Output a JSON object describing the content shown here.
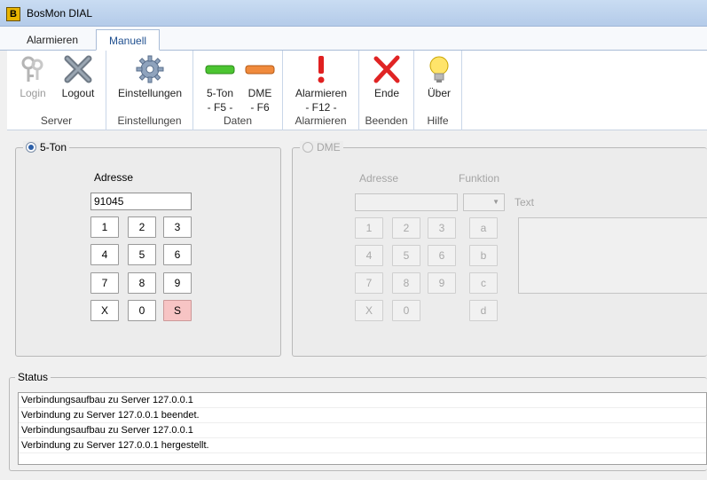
{
  "window": {
    "title": "BosMon DIAL",
    "icon_letter": "B"
  },
  "tabs": [
    {
      "label": "Alarmieren"
    },
    {
      "label": "Manuell"
    }
  ],
  "ribbon": {
    "groups": [
      {
        "label": "Server",
        "buttons": [
          {
            "label": "Login"
          },
          {
            "label": "Logout"
          }
        ]
      },
      {
        "label": "Einstellungen",
        "buttons": [
          {
            "label": "Einstellungen"
          }
        ]
      },
      {
        "label": "Daten",
        "buttons": [
          {
            "line1": "5-Ton",
            "line2": "- F5 -"
          },
          {
            "line1": "DME",
            "line2": "- F6"
          }
        ]
      },
      {
        "label": "Alarmieren",
        "buttons": [
          {
            "line1": "Alarmieren",
            "line2": "- F12 -"
          }
        ]
      },
      {
        "label": "Beenden",
        "buttons": [
          {
            "label": "Ende"
          }
        ]
      },
      {
        "label": "Hilfe",
        "buttons": [
          {
            "label": "Über"
          }
        ]
      }
    ]
  },
  "five_tone": {
    "legend": "5-Ton",
    "address_label": "Adresse",
    "address_value": "91045",
    "keys": [
      "1",
      "2",
      "3",
      "4",
      "5",
      "6",
      "7",
      "8",
      "9",
      "X",
      "0",
      "S"
    ]
  },
  "dme": {
    "legend": "DME",
    "address_label": "Adresse",
    "function_label": "Funktion",
    "text_label": "Text",
    "keys": [
      "1",
      "2",
      "3",
      "4",
      "5",
      "6",
      "7",
      "8",
      "9",
      "X",
      "0"
    ],
    "letter_keys": [
      "a",
      "b",
      "c",
      "d"
    ]
  },
  "status": {
    "legend": "Status",
    "rows": [
      "Verbindungsaufbau zu Server 127.0.0.1",
      "Verbindung zu Server 127.0.0.1 beendet.",
      "Verbindungsaufbau zu Server 127.0.0.1",
      "Verbindung zu Server 127.0.0.1 hergestellt."
    ]
  },
  "colors": {
    "accent": "#1f4f8f",
    "s_key": "#f7c4c4",
    "alarm_red": "#e02020"
  }
}
